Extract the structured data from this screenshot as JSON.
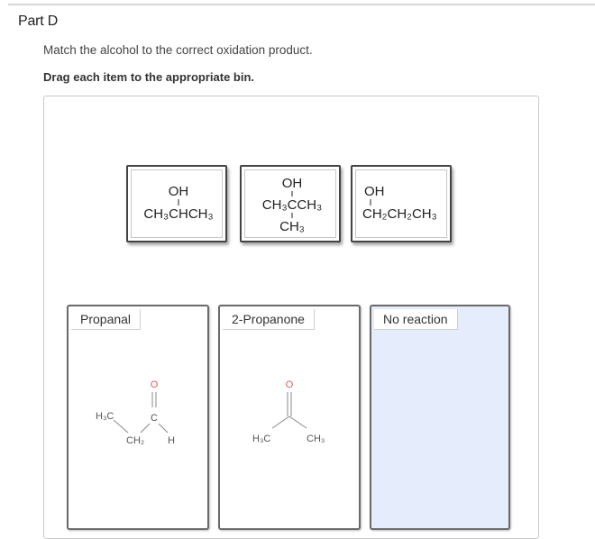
{
  "header": {
    "part_title": "Part D",
    "instruction": "Match the alcohol to the correct oxidation product.",
    "drag_instruction": "Drag each item to the appropriate bin."
  },
  "items": [
    {
      "oh": "OH",
      "formula_main": "CH₃CHCH₃"
    },
    {
      "oh": "OH",
      "formula_main": "CH₃CCH₃",
      "formula_sub": "CH₃"
    },
    {
      "oh": "OH",
      "formula_main": "CH₂CH₂CH₃"
    }
  ],
  "bins": [
    {
      "label": "Propanal",
      "atoms": {
        "o": "O",
        "c": "C",
        "h3c": "H₃C",
        "ch2": "CH₂",
        "h": "H"
      }
    },
    {
      "label": "2-Propanone",
      "atoms": {
        "o": "O",
        "h3c": "H₃C",
        "ch3": "CH₃"
      }
    },
    {
      "label": "No reaction"
    }
  ],
  "colors": {
    "oxygen": "#e05a5a",
    "bin_highlight": "#e5ecfb"
  }
}
